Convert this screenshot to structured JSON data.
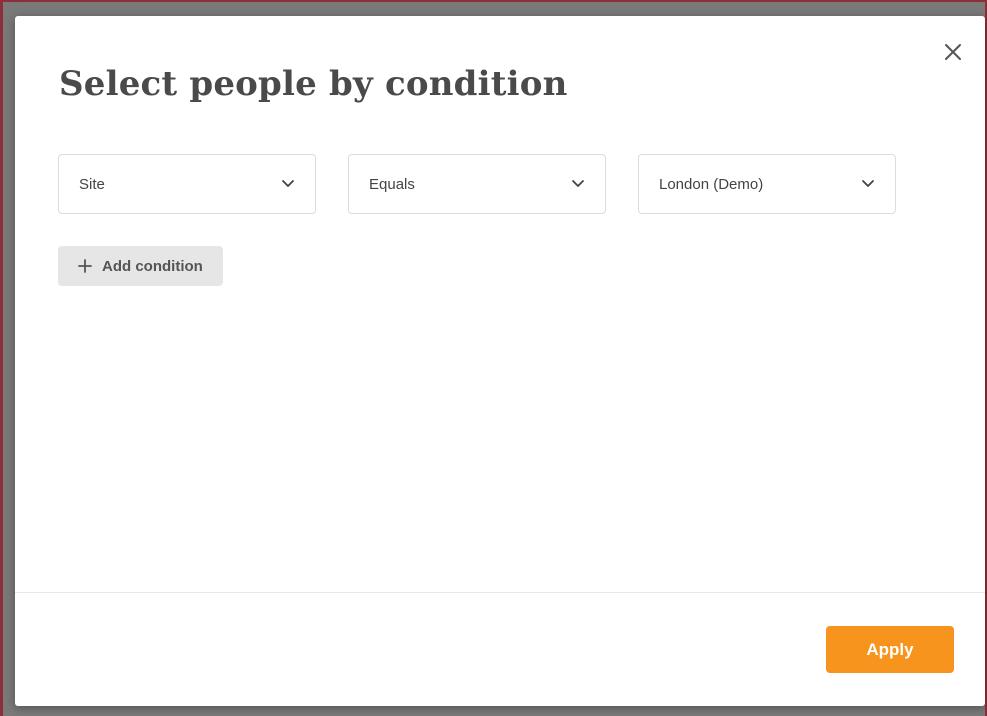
{
  "modal": {
    "title": "Select people by condition",
    "close_icon": "close-icon",
    "conditions": [
      {
        "field": "Site",
        "operator": "Equals",
        "value": "London (Demo)"
      }
    ],
    "add_condition_label": "Add condition",
    "apply_label": "Apply"
  },
  "colors": {
    "accent": "#f7941d",
    "title": "#4a4a4a",
    "add_button_bg": "#e6e6e6"
  },
  "icons": {
    "close": "close-icon",
    "dropdown": "chevron-down-icon",
    "add": "plus-icon"
  }
}
